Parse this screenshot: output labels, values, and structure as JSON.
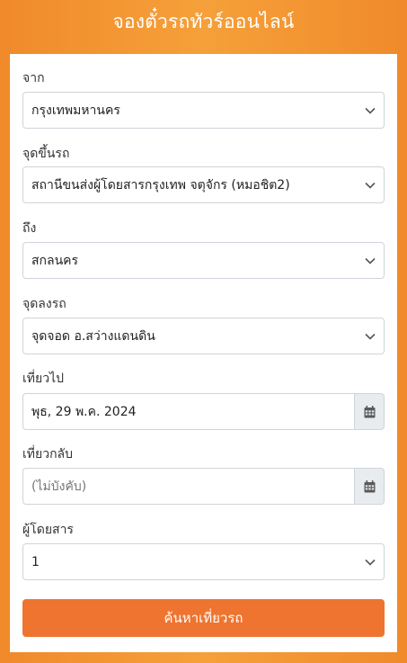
{
  "header": {
    "title": "จองตั๋วรถทัวร์ออนไลน์"
  },
  "form": {
    "from": {
      "label": "จาก",
      "value": "กรุงเทพมหานคร"
    },
    "pickup": {
      "label": "จุดขึ้นรถ",
      "value": "สถานีขนส่งผู้โดยสารกรุงเทพ จตุจักร (หมอชิต2)"
    },
    "to": {
      "label": "ถึง",
      "value": "สกลนคร"
    },
    "dropoff": {
      "label": "จุดลงรถ",
      "value": "จุดจอด อ.สว่างแดนดิน"
    },
    "depart": {
      "label": "เที่ยวไป",
      "value": "พุธ, 29 พ.ค. 2024"
    },
    "return": {
      "label": "เที่ยวกลับ",
      "placeholder": "(ไม่บังคับ)"
    },
    "passengers": {
      "label": "ผู้โดยสาร",
      "value": "1"
    },
    "search_label": "ค้นหาเที่ยวรถ"
  },
  "colors": {
    "background": "#f39533",
    "button": "#ee7430",
    "calendar_button_bg": "#e9ecef"
  },
  "icons": {
    "dropdown": "chevron-down-icon",
    "calendar": "calendar-icon"
  }
}
